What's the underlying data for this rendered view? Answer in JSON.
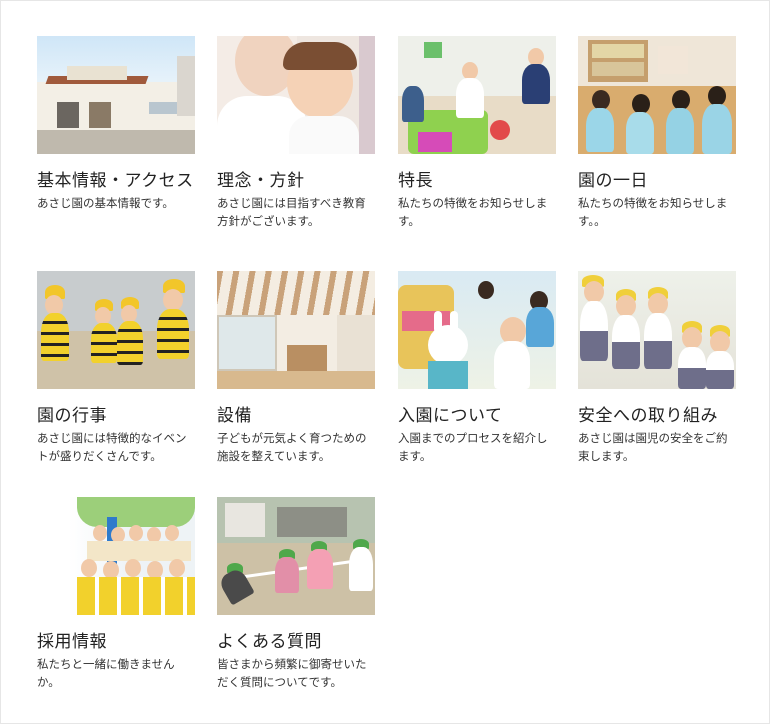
{
  "cards": [
    {
      "title": "基本情報・アクセス",
      "desc": "あさじ園の基本情報です。",
      "image_icon": "building-photo"
    },
    {
      "title": "理念・方針",
      "desc": "あさじ園には目指すべき教育方針がございます。",
      "image_icon": "mother-child-photo"
    },
    {
      "title": "特長",
      "desc": "私たちの特徴をお知らせします。",
      "image_icon": "playroom-photo"
    },
    {
      "title": "園の一日",
      "desc": "私たちの特徴をお知らせします。。",
      "image_icon": "classroom-photo"
    },
    {
      "title": "園の行事",
      "desc": "あさじ園には特徴的なイベントが盛りだくさんです。",
      "image_icon": "bee-costume-photo"
    },
    {
      "title": "設備",
      "desc": "子どもが元気よく育つための施設を整えています。",
      "image_icon": "hall-interior-photo"
    },
    {
      "title": "入園について",
      "desc": "入園までのプロセスを紹介します。",
      "image_icon": "playground-photo"
    },
    {
      "title": "安全への取り組み",
      "desc": "あさじ園は園児の安全をご約束します。",
      "image_icon": "uniform-kids-photo"
    },
    {
      "title": "採用情報",
      "desc": "私たちと一緒に働きませんか。",
      "image_icon": "group-photo"
    },
    {
      "title": "よくある質問",
      "desc": "皆さまから頻繁に御寄せいただく質問についてです。",
      "image_icon": "tug-of-war-photo"
    }
  ],
  "colors": {
    "background": "#ffffff",
    "text": "#222222",
    "accent_yellow": "#f2c62a"
  }
}
